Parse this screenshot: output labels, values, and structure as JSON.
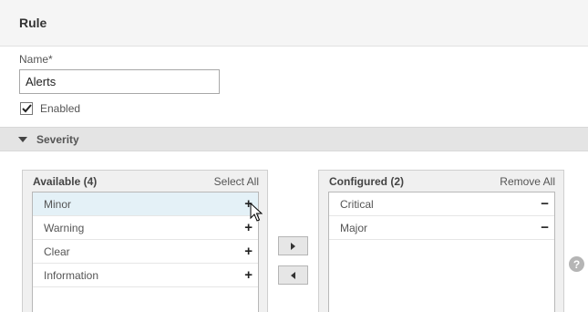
{
  "header": {
    "title": "Rule"
  },
  "form": {
    "name_label": "Name*",
    "name_value": "Alerts",
    "enabled_label": "Enabled",
    "enabled_checked": true
  },
  "section": {
    "title": "Severity",
    "expanded": true
  },
  "available": {
    "title": "Available (4)",
    "action": "Select All",
    "items": [
      {
        "label": "Minor",
        "op": "+"
      },
      {
        "label": "Warning",
        "op": "+"
      },
      {
        "label": "Clear",
        "op": "+"
      },
      {
        "label": "Information",
        "op": "+"
      }
    ]
  },
  "configured": {
    "title": "Configured (2)",
    "action": "Remove All",
    "items": [
      {
        "label": "Critical",
        "op": "−"
      },
      {
        "label": "Major",
        "op": "−"
      }
    ]
  },
  "help": {
    "label": "?"
  },
  "colors": {
    "hover_row": "#e4f1f7",
    "section_bar": "#e4e4e4",
    "header_bg": "#f5f5f5"
  }
}
